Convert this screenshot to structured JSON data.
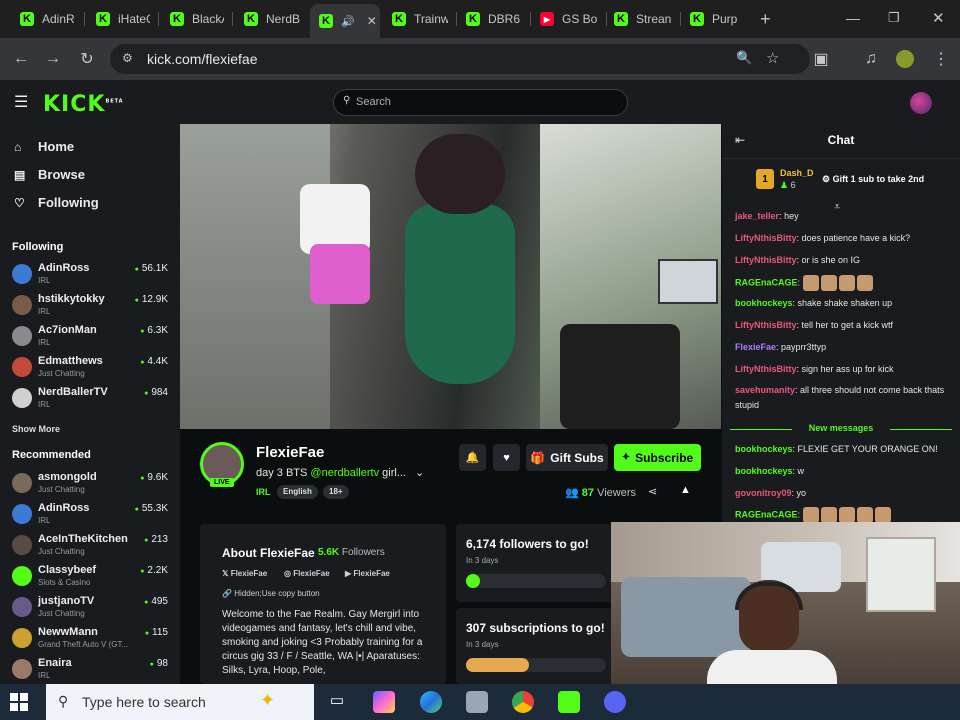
{
  "browser": {
    "tabs": [
      {
        "label": "AdinR",
        "icon": "kick-icon"
      },
      {
        "label": "iHateC",
        "icon": "kick-icon"
      },
      {
        "label": "BlackA",
        "icon": "kick-icon"
      },
      {
        "label": "NerdB",
        "icon": "kick-icon"
      },
      {
        "label": "",
        "icon": "kick-icon",
        "active": true
      },
      {
        "label": "Trainw",
        "icon": "kick-icon"
      },
      {
        "label": "DBR6",
        "icon": "kick-icon"
      },
      {
        "label": "GS Bo",
        "icon": "youtube-icon"
      },
      {
        "label": "Strean",
        "icon": "kick-icon"
      },
      {
        "label": "Purp",
        "icon": "kick-icon"
      }
    ],
    "new_tab": "+",
    "url": "kick.com/flexiefae"
  },
  "kick": {
    "logo": "KICK",
    "logo_sup": "BETA",
    "search_placeholder": "Search"
  },
  "sidebar": {
    "nav": [
      {
        "label": "Home",
        "icon": "home-icon"
      },
      {
        "label": "Browse",
        "icon": "browse-icon"
      },
      {
        "label": "Following",
        "icon": "heart-icon"
      }
    ],
    "following_title": "Following",
    "following": [
      {
        "name": "AdinRoss",
        "category": "IRL",
        "viewers": "56.1K",
        "color": "#3b7bd6"
      },
      {
        "name": "hstikkytokky",
        "category": "IRL",
        "viewers": "12.9K",
        "color": "#7a5a48"
      },
      {
        "name": "Ac7ionMan",
        "category": "IRL",
        "viewers": "6.3K",
        "color": "#8a8a8a"
      },
      {
        "name": "Edmatthews",
        "category": "Just Chatting",
        "viewers": "4.4K",
        "color": "#c24a3a"
      },
      {
        "name": "NerdBallerTV",
        "category": "IRL",
        "viewers": "984",
        "color": "#d0d0d0"
      }
    ],
    "show_more": "Show More",
    "recommended_title": "Recommended",
    "recommended": [
      {
        "name": "asmongold",
        "category": "Just Chatting",
        "viewers": "9.6K",
        "color": "#7a6a5a"
      },
      {
        "name": "AdinRoss",
        "category": "IRL",
        "viewers": "55.3K",
        "color": "#3b7bd6"
      },
      {
        "name": "AceInTheKitchen",
        "category": "Just Chatting",
        "viewers": "213",
        "color": "#5a4a44"
      },
      {
        "name": "Classybeef",
        "category": "Slots & Casino",
        "viewers": "2.2K",
        "color": "#53fc18"
      },
      {
        "name": "justjanoTV",
        "category": "Just Chatting",
        "viewers": "495",
        "color": "#6a5a8a"
      },
      {
        "name": "NewwMann",
        "category": "Grand Theft Auto V (GT...",
        "viewers": "115",
        "color": "#caa030"
      },
      {
        "name": "Enaira",
        "category": "IRL",
        "viewers": "98",
        "color": "#9a7a6a"
      }
    ]
  },
  "stream": {
    "name": "FlexieFae",
    "live": "LIVE",
    "title_prefix": "day 3 BTS",
    "title_mention": "@nerdballertv",
    "title_suffix": "girl...",
    "category": "IRL",
    "tags": [
      "English",
      "18+"
    ],
    "gift_subs": "Gift Subs",
    "subscribe": "Subscribe",
    "viewers": "87",
    "viewers_label": "Viewers"
  },
  "about": {
    "title": "About FlexieFae",
    "followers": "5.6K",
    "followers_label": "Followers",
    "socials": [
      {
        "label": "FlexieFae",
        "icon": "x-icon"
      },
      {
        "label": "FlexieFae",
        "icon": "instagram-icon"
      },
      {
        "label": "FlexieFae",
        "icon": "youtube-icon"
      }
    ],
    "hidden_text": "Hidden;Use copy button",
    "bio": "Welcome to the Fae Realm. Gay Mergirl into videogames and fantasy, let's chill and vibe, smoking and joking <3 Probably training for a circus gig 33 / F / Seattle, WA |•| Aparatuses: Silks, Lyra, Hoop, Pole,"
  },
  "goals": [
    {
      "title": "6,174 followers to go!",
      "date": "In 3 days",
      "progress": 0.08,
      "color": "#53fc18"
    },
    {
      "title": "307 subscriptions to go!",
      "date": "In 3 days",
      "progress": 0.45,
      "color": "#e8a850"
    }
  ],
  "chat": {
    "title": "Chat",
    "pinned": {
      "name": "Dash_D",
      "count": "6",
      "rank": "1",
      "cta": "Gift 1 sub to take 2nd"
    },
    "messages": [
      {
        "user": "jake_teller",
        "text": "hey",
        "color": "#e8577a"
      },
      {
        "user": "LiftyNthisBitty",
        "text": "does patience have a kick?",
        "color": "#e8577a"
      },
      {
        "user": "LiftyNthisBitty",
        "text": "or is she on IG",
        "color": "#e8577a"
      },
      {
        "user": "RAGEnaCAGE",
        "text": "",
        "color": "#53fc18",
        "emotes": 4
      },
      {
        "user": "bookhockeys",
        "text": "shake shake shaken up",
        "color": "#53fc18"
      },
      {
        "user": "LiftyNthisBitty",
        "text": "tell her to get a kick wtf",
        "color": "#e8577a"
      },
      {
        "user": "FlexieFae",
        "text": "payprr3ttyp",
        "color": "#b57bff"
      },
      {
        "user": "LiftyNthisBitty",
        "text": "sign her ass up for kick",
        "color": "#e8577a"
      },
      {
        "user": "savehumanity",
        "text": "all three should not come back thats stupid",
        "color": "#e8577a"
      }
    ],
    "new_messages_label": "New messages",
    "new_messages": [
      {
        "user": "bookhockeys",
        "text": "FLEXIE GET YOUR ORANGE ON!",
        "color": "#53fc18"
      },
      {
        "user": "bookhockeys",
        "text": "w",
        "color": "#53fc18"
      },
      {
        "user": "govonitroy09",
        "text": "yo",
        "color": "#e8577a"
      },
      {
        "user": "RAGEnaCAGE",
        "text": "",
        "color": "#53fc18",
        "emotes": 5
      }
    ]
  },
  "taskbar": {
    "search_placeholder": "Type here to search"
  }
}
